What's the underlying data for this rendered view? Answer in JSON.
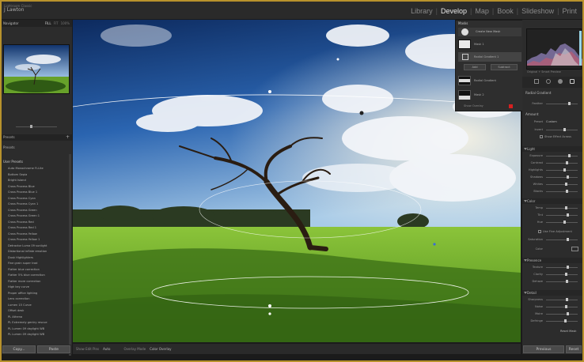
{
  "app": {
    "id_line": "Lightroom Classic",
    "user": "J Lawton"
  },
  "modules": [
    "Library",
    "Develop",
    "Map",
    "Book",
    "Slideshow",
    "Print"
  ],
  "active_module": "Develop",
  "navigator": {
    "title": "Navigator",
    "zoom_options": [
      "FILL",
      "FIT",
      "100%"
    ]
  },
  "left_panels": {
    "presets_header": "Presets",
    "presets_sub": "Presets",
    "folder_label": "User Presets"
  },
  "presets": [
    "Auto Monochrome Fi-Lite",
    "Bottom Sepia",
    "Bright Island",
    "Cross Process Blue",
    "Cross Process Blue 1",
    "Cross Process Cyan",
    "Cross Process Cyan 1",
    "Cross Process Green",
    "Cross Process Green 1",
    "Cross Process Red",
    "Cross Process Red 1",
    "Cross Process Yellow",
    "Cross Process Yellow 1",
    "Detractor Luma 09 sunlight",
    "Distortional inflate emotion",
    "Dusk Highlighters",
    "Fine grain super trad",
    "Flatter blue correction",
    "Flatter 5% blue correction",
    "Flatter more correction",
    "High key curve",
    "Proper office lighting",
    "Lens correction",
    "Lumen 15 Curve",
    "Offset desk",
    "PL Athena",
    "PL Extremely gentry rescue",
    "PL Lumen 09 daylight WB",
    "PL Lumen 09 daylight WB"
  ],
  "left_buttons": {
    "copy": "Copy...",
    "paste": "Paste"
  },
  "toolbar": {
    "show_pin_label": "Show Edit Pins",
    "show_pin_value": "Auto",
    "overlay_label": "Overlay Mode",
    "overlay_value": "Color Overlay"
  },
  "masks": {
    "title": "Masks",
    "create_label": "Create New Mask",
    "mask_label": "Mask 1",
    "gradient_label": "Radial Gradient 1",
    "add_label": "Add",
    "subtract_label": "Subtract",
    "mask2_label": "Radial Gradient",
    "mask3_label": "Mask 2",
    "show_overlay": "Show Overlay"
  },
  "right_panel": {
    "histogram_label": "Original + Smart Preview",
    "mask_section_title": "Radial Gradient",
    "feather_label": "Feather",
    "amount_label": "Amount",
    "preset_label": "Preset",
    "preset_value": "Custom",
    "amount2_label": "Invert",
    "show_mask": "Show Effect Across",
    "sections": {
      "light": "Light",
      "color": "Color",
      "presence": "Presence",
      "detail": "Detail"
    },
    "light_rows": [
      "Exposure",
      "Contrast",
      "Highlights",
      "Shadows",
      "Whites",
      "Blacks"
    ],
    "color_rows": [
      "Temp",
      "Tint",
      "Hue"
    ],
    "color_extra": [
      "Use Fine Adjustment",
      "Saturation"
    ],
    "color_label": "Color",
    "presence_rows": [
      "Texture",
      "Clarity",
      "Dehaze"
    ],
    "detail_rows": [
      "Sharpness",
      "Noise",
      "Moire",
      "Defringe"
    ],
    "reset_label": "Reset Mask",
    "buttons": {
      "previous": "Previous",
      "reset": "Reset"
    }
  },
  "colors": {
    "accent_frame": "#b8922c",
    "panel": "#2c2c2c",
    "sky": "#1a3f7a",
    "grass": "#5a8a20"
  }
}
